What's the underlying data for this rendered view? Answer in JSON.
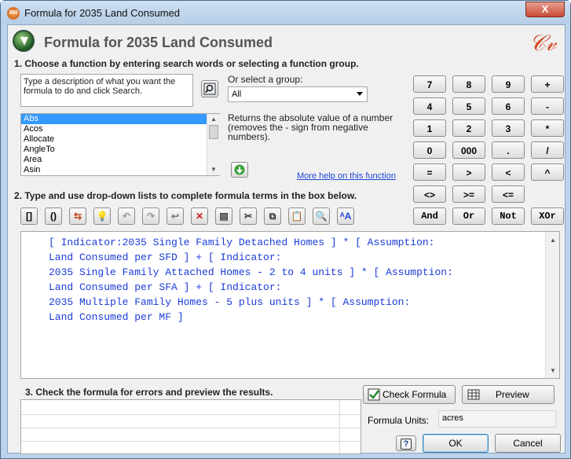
{
  "window": {
    "title": "Formula for 2035 Land Consumed",
    "close": "X"
  },
  "header": {
    "title": "Formula for 2035 Land Consumed",
    "logo": "CV"
  },
  "step1": {
    "label": "1. Choose a function by entering search words or selecting a function group.",
    "search_placeholder": "Type a description of what you want the formula to do and click Search.",
    "group_label": "Or select a group:",
    "group_value": "All",
    "functions": [
      "Abs",
      "Acos",
      "Allocate",
      "AngleTo",
      "Area",
      "Asin"
    ],
    "selected_function": "Abs",
    "description": "Returns the absolute value of a number (removes the - sign from negative numbers).",
    "more_help": "More help on this function"
  },
  "keypad": {
    "rows": [
      [
        "7",
        "8",
        "9",
        "+"
      ],
      [
        "4",
        "5",
        "6",
        "-"
      ],
      [
        "1",
        "2",
        "3",
        "*"
      ],
      [
        "0",
        "000",
        ".",
        "/"
      ],
      [
        "=",
        ">",
        "<",
        "^"
      ],
      [
        "<>",
        ">=",
        "<="
      ]
    ],
    "logic": [
      "And",
      "Or",
      "Not",
      "XOr"
    ]
  },
  "step2": {
    "label": "2. Type and use drop-down lists to complete formula terms in the box below.",
    "toolbar": [
      "[]",
      "()",
      "swap-icon",
      "hint-icon",
      "undo-icon",
      "redo-icon",
      "insert-icon",
      "delete-icon",
      "paste-special-icon",
      "cut-icon",
      "copy-icon",
      "paste-icon",
      "find-icon",
      "case-icon"
    ],
    "formula_lines": [
      "[ Indicator:2035 Single Family Detached Homes ] * [ Assumption:",
      "Land Consumed per SFD ] + [ Indicator:",
      "2035 Single Family Attached Homes - 2 to 4 units ] * [ Assumption:",
      "Land Consumed per SFA ] + [ Indicator:",
      "2035 Multiple Family Homes - 5 plus units ] * [ Assumption:",
      "Land Consumed per MF ]"
    ]
  },
  "step3": {
    "label": "3. Check the formula for errors and preview the results.",
    "check_label": "Check Formula",
    "preview_label": "Preview",
    "units_label": "Formula Units:",
    "units_value": "acres",
    "ok_label": "OK",
    "cancel_label": "Cancel"
  }
}
